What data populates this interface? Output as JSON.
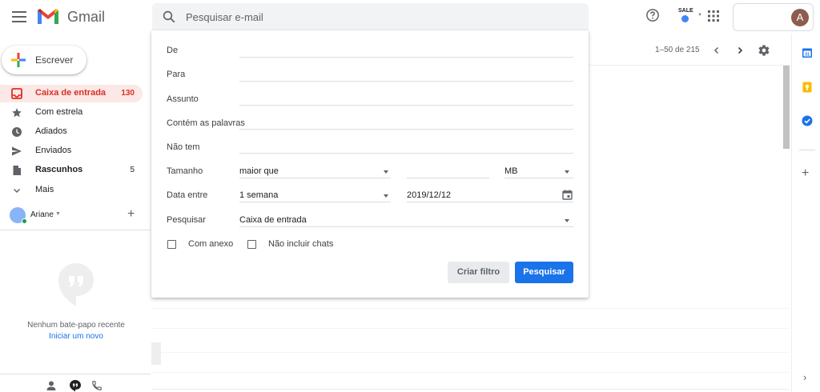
{
  "header": {
    "brand": "Gmail",
    "search_placeholder": "Pesquisar e-mail",
    "sale_label": "SALE",
    "avatar_letter": "A"
  },
  "nav": {
    "compose_label": "Escrever",
    "items": [
      {
        "label": "Caixa de entrada",
        "count": "130",
        "icon": "inbox-icon"
      },
      {
        "label": "Com estrela",
        "count": "",
        "icon": "star-icon"
      },
      {
        "label": "Adiados",
        "count": "",
        "icon": "clock-icon"
      },
      {
        "label": "Enviados",
        "count": "",
        "icon": "send-icon"
      },
      {
        "label": "Rascunhos",
        "count": "5",
        "icon": "draft-icon"
      },
      {
        "label": "Mais",
        "count": "",
        "icon": "chevron-down-icon"
      }
    ],
    "user_name": "Ariane",
    "chat_empty_text": "Nenhum bate-papo recente",
    "chat_start_link": "Iniciar um novo"
  },
  "toolbar": {
    "pagination": "1–50 de 215"
  },
  "advanced_search": {
    "from_label": "De",
    "to_label": "Para",
    "subject_label": "Assunto",
    "has_words_label": "Contém as palavras",
    "doesnt_have_label": "Não tem",
    "size_label": "Tamanho",
    "size_operator": "maior que",
    "size_unit": "MB",
    "date_within_label": "Data entre",
    "date_within_value": "1 semana",
    "date_value": "2019/12/12",
    "search_in_label": "Pesquisar",
    "search_in_value": "Caixa de entrada",
    "has_attachment_label": "Com anexo",
    "exclude_chats_label": "Não incluir chats",
    "create_filter_label": "Criar filtro",
    "search_button_label": "Pesquisar"
  },
  "colors": {
    "accent": "#1a73e8",
    "inbox_highlight": "#fce8e6",
    "inbox_text": "#d93025"
  }
}
